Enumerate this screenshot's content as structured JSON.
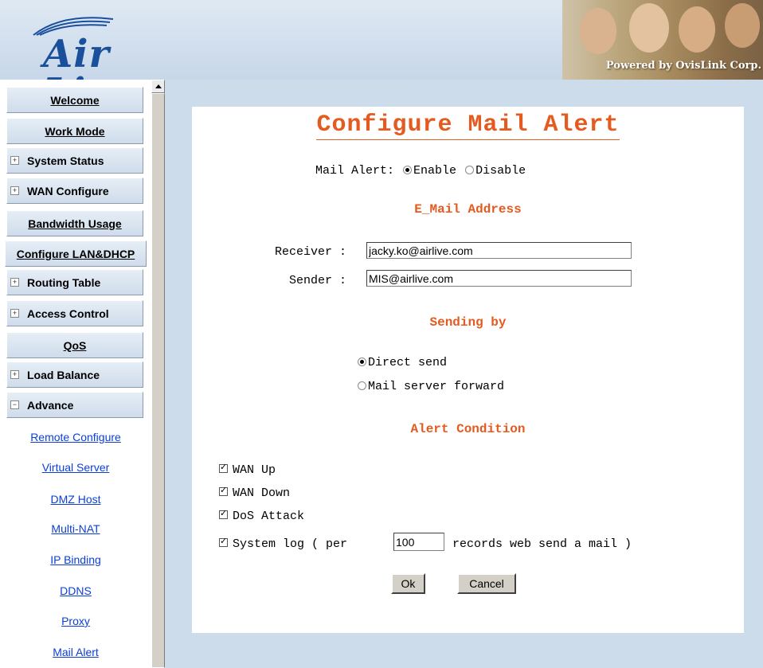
{
  "header": {
    "logo_text": "Air Live",
    "logo_mark": "®",
    "powered_by": "Powered by OvisLink Corp."
  },
  "sidebar": {
    "welcome": "Welcome",
    "work_mode": "Work Mode",
    "system_status": "System Status",
    "wan_configure": "WAN Configure",
    "bandwidth_usage": "Bandwidth Usage",
    "configure_lan": "Configure LAN&DHCP",
    "routing_table": "Routing Table",
    "access_control": "Access Control",
    "qos": "QoS",
    "load_balance": "Load Balance",
    "advance": "Advance",
    "expand_glyph": "+",
    "collapse_glyph": "−",
    "sub": {
      "remote_configure": "Remote Configure",
      "virtual_server": "Virtual Server",
      "dmz_host": "DMZ Host",
      "multi_nat": "Multi-NAT",
      "ip_binding": "IP Binding",
      "ddns": "DDNS",
      "proxy": "Proxy",
      "mail_alert": "Mail Alert"
    }
  },
  "form": {
    "title": "Configure Mail Alert",
    "mail_alert_label": "Mail Alert:",
    "enable_label": "Enable",
    "disable_label": "Disable",
    "mail_alert_selected": "Enable",
    "email_section": "E_Mail Address",
    "receiver_label": "Receiver :",
    "receiver_value": "jacky.ko@airlive.com",
    "sender_label": "Sender :",
    "sender_value": "MIS@airlive.com",
    "sending_section": "Sending by",
    "direct_send_label": "Direct send",
    "mail_server_label": "Mail server forward",
    "sending_selected": "Direct send",
    "alert_section": "Alert Condition",
    "wan_up_label": "WAN Up",
    "wan_down_label": "WAN Down",
    "dos_label": "DoS Attack",
    "syslog_prefix": "System log ( per",
    "syslog_value": "100",
    "syslog_suffix": "records web send a mail )",
    "conditions_checked": [
      "WAN Up",
      "WAN Down",
      "DoS Attack",
      "System log"
    ],
    "ok_label": "Ok",
    "cancel_label": "Cancel"
  },
  "colors": {
    "accent_orange": "#e55a1f",
    "link_blue": "#0b3fd6",
    "main_background": "#cddceb"
  }
}
